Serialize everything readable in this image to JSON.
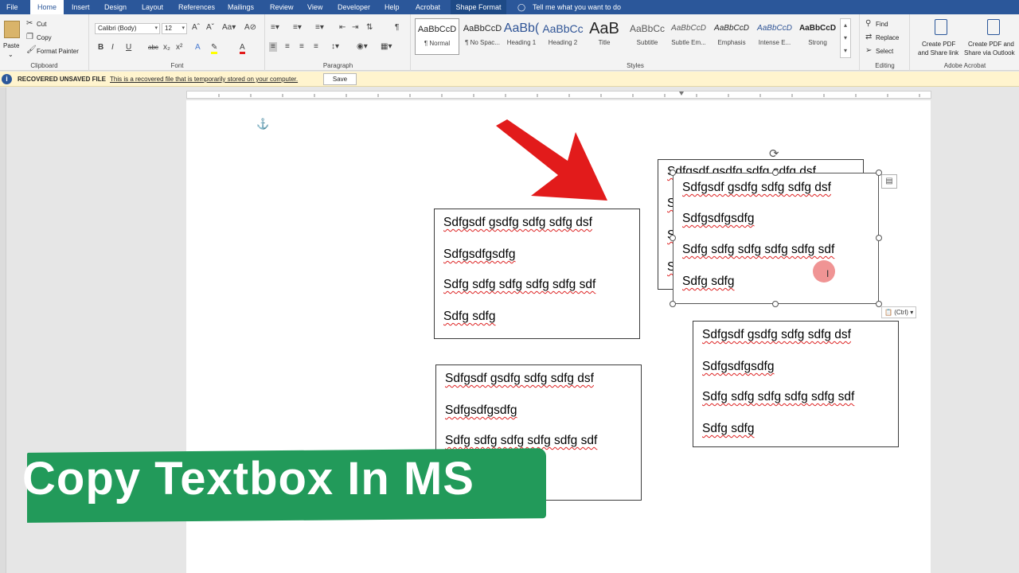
{
  "tabs": [
    "File",
    "Home",
    "Insert",
    "Design",
    "Layout",
    "References",
    "Mailings",
    "Review",
    "View",
    "Developer",
    "Help",
    "Acrobat",
    "Shape Format"
  ],
  "tell_me": "Tell me what you want to do",
  "clipboard": {
    "paste": "Paste",
    "cut": "Cut",
    "copy": "Copy",
    "format_painter": "Format Painter",
    "label": "Clipboard"
  },
  "font": {
    "name": "Calibri (Body)",
    "size": "12",
    "label": "Font"
  },
  "paragraph": {
    "label": "Paragraph"
  },
  "styles": {
    "label": "Styles",
    "items": [
      {
        "preview": "AaBbCcD",
        "name": "¶ Normal"
      },
      {
        "preview": "AaBbCcD",
        "name": "¶ No Spac..."
      },
      {
        "preview": "AaBb(",
        "name": "Heading 1"
      },
      {
        "preview": "AaBbCc",
        "name": "Heading 2"
      },
      {
        "preview": "AaB",
        "name": "Title"
      },
      {
        "preview": "AaBbCc",
        "name": "Subtitle"
      },
      {
        "preview": "AaBbCcD",
        "name": "Subtle Em..."
      },
      {
        "preview": "AaBbCcD",
        "name": "Emphasis"
      },
      {
        "preview": "AaBbCcD",
        "name": "Intense E..."
      },
      {
        "preview": "AaBbCcD",
        "name": "Strong"
      }
    ]
  },
  "editing": {
    "find": "Find",
    "replace": "Replace",
    "select": "Select",
    "label": "Editing"
  },
  "acrobat": {
    "create1_l1": "Create PDF",
    "create1_l2": "and Share link",
    "create2_l1": "Create PDF and",
    "create2_l2": "Share via Outlook",
    "label": "Adobe Acrobat"
  },
  "message_bar": {
    "title": "RECOVERED UNSAVED FILE",
    "text": "This is a recovered file that is temporarily stored on your computer.",
    "button": "Save"
  },
  "textbox_lines": [
    "Sdfgsdf gsdfg sdfg sdfg dsf",
    "Sdfgsdfgsdfg",
    "Sdfg sdfg sdfg sdfg sdfg sdf",
    "Sdfg sdfg"
  ],
  "paste_options": "(Ctrl)",
  "banner": "Copy Textbox In MS",
  "colors": {
    "ribbon_blue": "#2b579a",
    "arrow_red": "#e21b1b",
    "banner_green": "#229a5a",
    "message_yellow": "#fff4ce"
  }
}
